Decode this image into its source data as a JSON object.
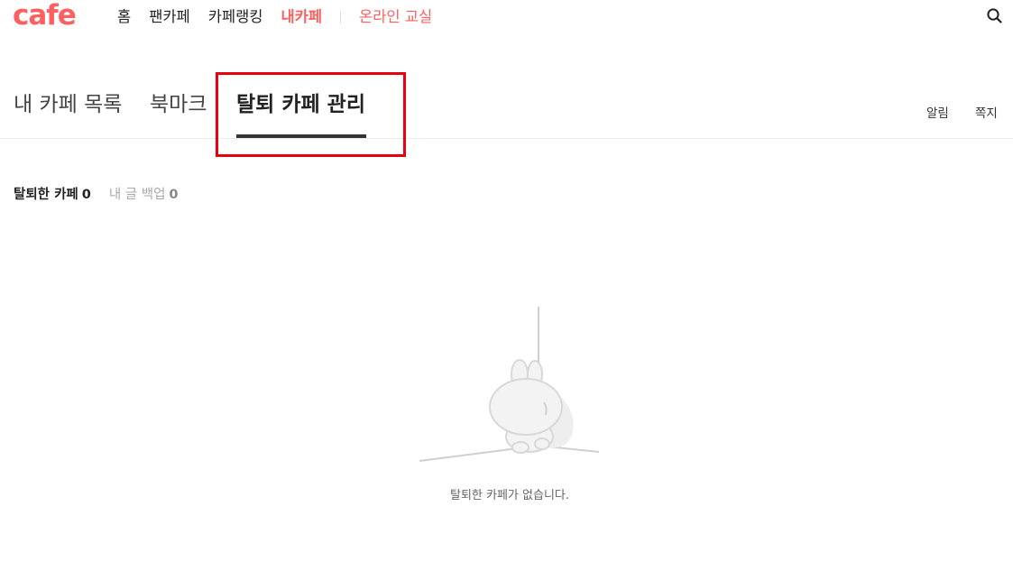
{
  "header": {
    "logo": "cafe",
    "menu": [
      {
        "label": "홈"
      },
      {
        "label": "팬카페"
      },
      {
        "label": "카페랭킹"
      },
      {
        "label": "내카페"
      },
      {
        "label": "온라인 교실"
      }
    ],
    "search_icon": "search-icon",
    "accent_color": "#ff5f5f"
  },
  "tabs": {
    "items": [
      {
        "label": "내 카페 목록"
      },
      {
        "label": "북마크"
      },
      {
        "label": "탈퇴 카페 관리"
      }
    ],
    "selected": "탈퇴 카페 관리",
    "utils": [
      {
        "label": "알림"
      },
      {
        "label": "쪽지"
      }
    ]
  },
  "subfilter": {
    "items": [
      {
        "label": "탈퇴한 카페",
        "count": "0"
      },
      {
        "label": "내 글 백업",
        "count": "0"
      }
    ]
  },
  "empty_state": {
    "message": "탈퇴한 카페가 없습니다.",
    "illustration": "rabbit-sitting-in-corner"
  },
  "highlight_color": "#e8000b"
}
